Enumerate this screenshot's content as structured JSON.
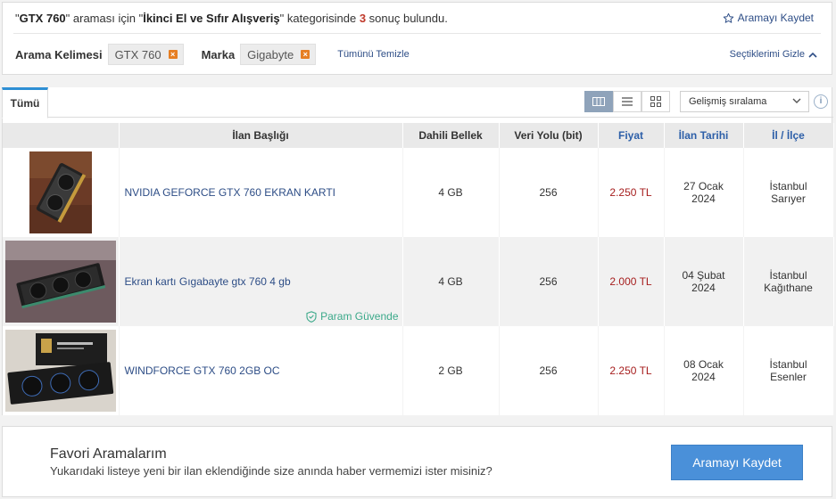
{
  "summary": {
    "q_open": "\"",
    "query": "GTX 760",
    "q_mid": "\" araması için ",
    "c_open": "\"",
    "category": "İkinci El ve Sıfır Alışveriş",
    "c_mid": "\" kategorisinde ",
    "count": "3",
    "tail": " sonuç bulundu.",
    "save_search": "Aramayı Kaydet"
  },
  "filters": {
    "keyword_label": "Arama Kelimesi",
    "keyword_value": "GTX 760",
    "brand_label": "Marka",
    "brand_value": "Gigabyte",
    "remove_symbol": "×",
    "clear_all": "Tümünü Temizle",
    "hide_selections": "Seçtiklerimi Gizle"
  },
  "tabs": {
    "all": "Tümü"
  },
  "sort": {
    "selected": "Gelişmiş sıralama"
  },
  "info": "i",
  "table": {
    "headers": {
      "title": "İlan Başlığı",
      "memory": "Dahili Bellek",
      "bus": "Veri Yolu (bit)",
      "price": "Fiyat",
      "date": "İlan Tarihi",
      "location": "İl / İlçe"
    },
    "rows": [
      {
        "title": "NVIDIA GEFORCE GTX 760 EKRAN KARTI",
        "memory": "4 GB",
        "bus": "256",
        "price": "2.250 TL",
        "date_day": "27 Ocak",
        "date_year": "2024",
        "city": "İstanbul",
        "district": "Sarıyer",
        "badge": ""
      },
      {
        "title": "Ekran kartı Gıgabayte gtx 760 4 gb",
        "memory": "4 GB",
        "bus": "256",
        "price": "2.000 TL",
        "date_day": "04 Şubat",
        "date_year": "2024",
        "city": "İstanbul",
        "district": "Kağıthane",
        "badge": "Param Güvende"
      },
      {
        "title": "WINDFORCE GTX 760 2GB OC",
        "memory": "2 GB",
        "bus": "256",
        "price": "2.250 TL",
        "date_day": "08 Ocak",
        "date_year": "2024",
        "city": "İstanbul",
        "district": "Esenler",
        "badge": ""
      }
    ]
  },
  "favorites": {
    "title": "Favori Aramalarım",
    "description": "Yukarıdaki listeye yeni bir ilan eklendiğinde size anında haber vermemizi ister misiniz?",
    "button": "Aramayı Kaydet"
  },
  "colors": {
    "accent": "#4a90d9",
    "price": "#a61e1e",
    "link": "#2d4d86",
    "secure": "#3ca98a",
    "chip_remove": "#e67e22"
  }
}
